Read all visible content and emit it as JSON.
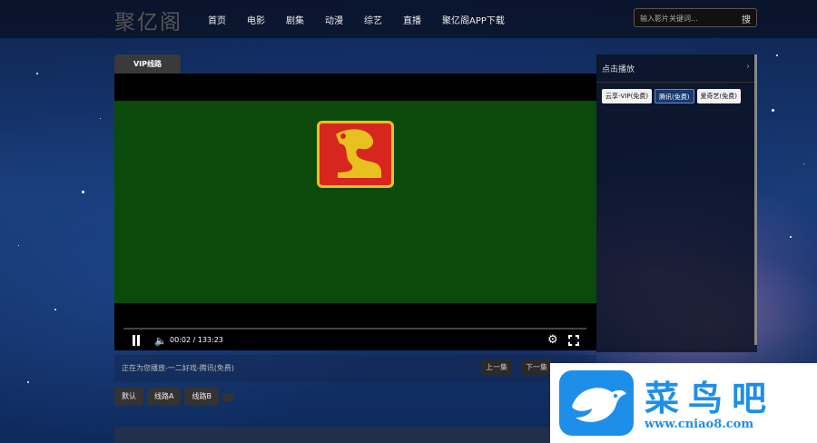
{
  "header": {
    "logo": "聚亿阁",
    "nav": [
      "首页",
      "电影",
      "剧集",
      "动漫",
      "综艺",
      "直播",
      "聚亿阁APP下载"
    ],
    "search_placeholder": "输入影片关键词...",
    "search_button": "搜"
  },
  "player": {
    "tab_label": "VIP线路",
    "time": "00:02 / 133:23"
  },
  "now_playing": {
    "text": "正在为您播放-一二好戏-腾讯(免费)",
    "prev": "上一集",
    "next": "下一集"
  },
  "lines": [
    "默认",
    "线路A",
    "线路B"
  ],
  "sidebar": {
    "title": "点击播放",
    "buttons": [
      "云享-VIP(免费)",
      "腾讯(免费)",
      "爱奇艺(免费)"
    ],
    "active_index": 1
  },
  "watermark": {
    "text": "菜鸟吧",
    "url": "www.cniao8.com"
  }
}
